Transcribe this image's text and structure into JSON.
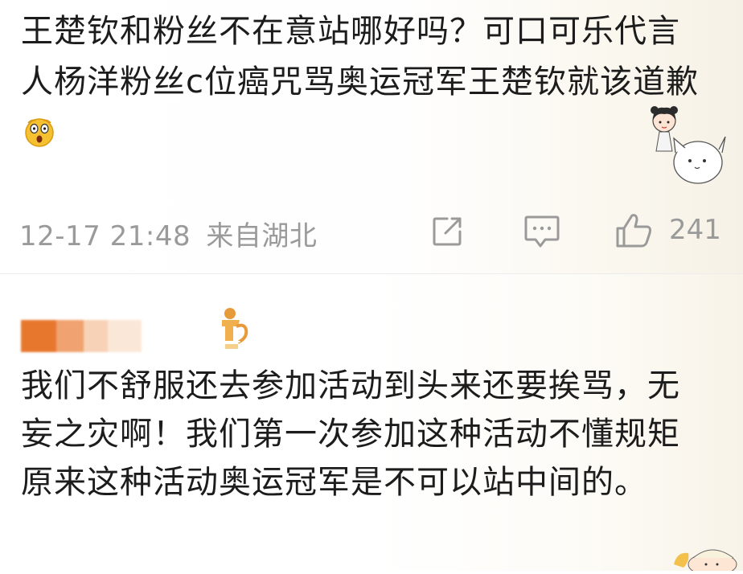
{
  "post": {
    "text": "王楚钦和粉丝不在意站哪好吗？可口可乐代言人杨洋粉丝c位癌咒骂奥运冠军王楚钦就该道歉",
    "emoji": "shocked-face-icon"
  },
  "meta": {
    "time": "12-17 21:48",
    "location": "来自湖北",
    "repost_icon": "share-icon",
    "comment_icon": "comment-icon",
    "like_icon": "thumbs-up-icon",
    "like_count": "241"
  },
  "reply": {
    "badge_icon": "member-badge-icon",
    "text": "我们不舒服还去参加活动到头来还要挨骂，无妄之灾啊！我们第一次参加这种活动不懂规矩原来这种活动奥运冠军是不可以站中间的。"
  },
  "colors": {
    "accent_orange": "#e8772e",
    "meta_gray": "#9a9a9a",
    "text": "#1c1c1c"
  }
}
